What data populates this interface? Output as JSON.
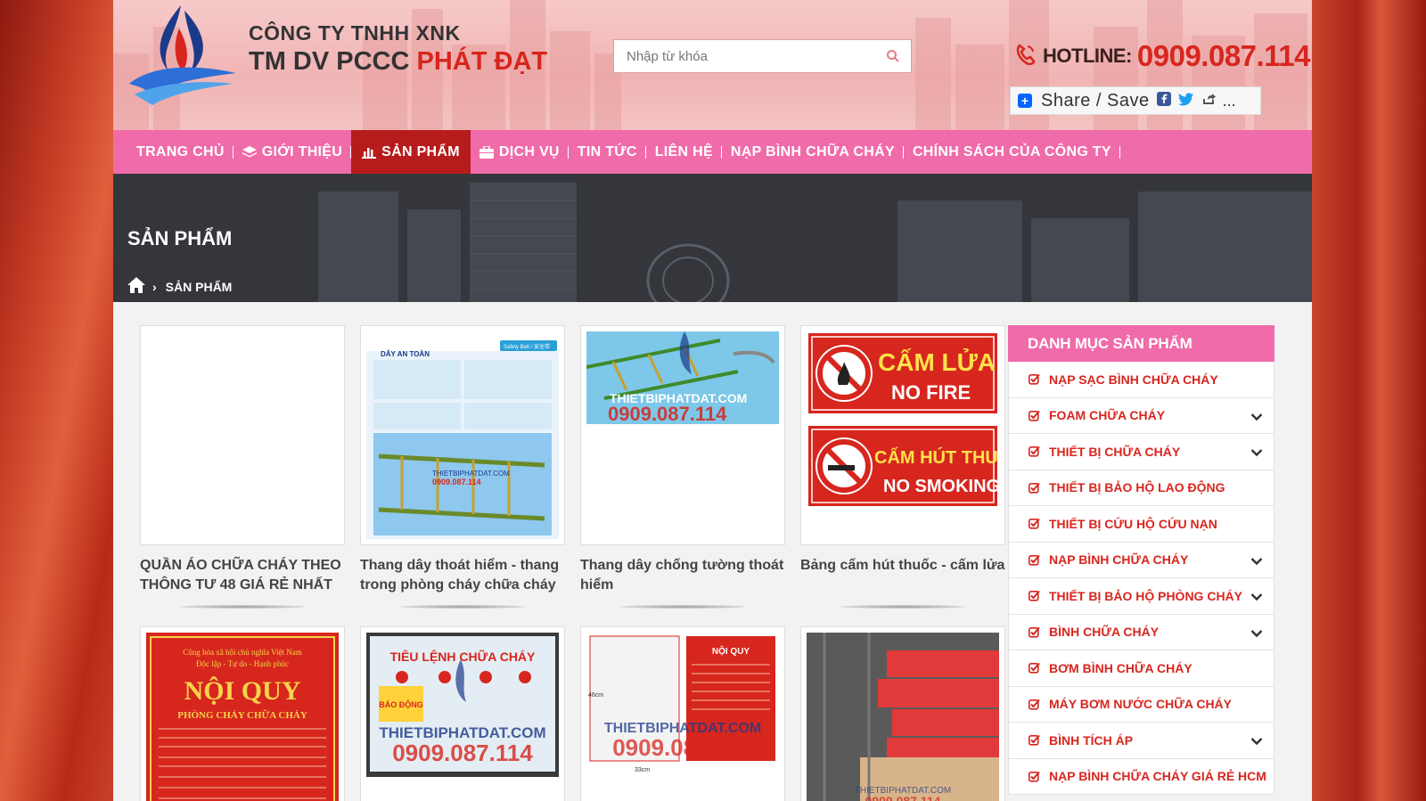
{
  "header": {
    "company_line1": "CÔNG TY TNHH XNK",
    "company_line2_prefix": "TM DV PCCC",
    "company_line2_brand": "PHÁT ĐẠT",
    "search_placeholder": "Nhập từ khóa",
    "hotline_label": "HOTLINE:",
    "hotline_number": "0909.087.114",
    "share_label": "Share / Save",
    "share_more": "..."
  },
  "nav": {
    "items": [
      {
        "label": "TRANG CHỦ",
        "icon": ""
      },
      {
        "label": "GIỚI THIỆU",
        "icon": "layers-icon"
      },
      {
        "label": "SẢN PHẨM",
        "icon": "chart-icon",
        "active": true
      },
      {
        "label": "DỊCH VỤ",
        "icon": "briefcase-icon"
      },
      {
        "label": "TIN TỨC",
        "icon": ""
      },
      {
        "label": "LIÊN HỆ",
        "icon": ""
      },
      {
        "label": "NẠP BÌNH CHỮA CHÁY",
        "icon": ""
      },
      {
        "label": "CHÍNH SÁCH CỦA CÔNG TY",
        "icon": ""
      }
    ]
  },
  "banner": {
    "title": "SẢN PHẨM",
    "breadcrumb_current": "SẢN PHẨM"
  },
  "products": [
    {
      "name": "QUẦN ÁO CHỮA CHÁY THEO THÔNG TƯ 48 GIÁ RẺ NHẤT"
    },
    {
      "name": "Thang dây thoát hiểm - thang trong phòng cháy chữa cháy"
    },
    {
      "name": "Thang dây chống tường thoát hiểm"
    },
    {
      "name": "Bảng cấm hút thuốc - cấm lửa"
    }
  ],
  "product_images": {
    "safety_title": "DÂY AN TOÀN",
    "safety_badge": "Safety Belt / 安全带",
    "watermark_site": "THIETBIPHATDAT.COM",
    "watermark_phone": "0909.087.114",
    "sign_fire_vi": "CẤM LỬA",
    "sign_fire_en": "NO FIRE",
    "sign_smoke_vi": "CẤM HÚT THUỐC",
    "sign_smoke_en": "NO SMOKING",
    "rules_header1": "Cộng hòa xã hội chủ nghĩa Việt Nam",
    "rules_header2": "Độc lập - Tự do - Hạnh phúc",
    "rules_title": "NỘI QUY",
    "rules_subtitle": "PHÒNG CHÁY CHỮA CHÁY",
    "command_title": "TIÊU LỆNH CHỮA CHÁY",
    "alarm_text": "BÁO ĐỘNG",
    "rules2_title": "NỘI QUY",
    "dim_46": "46cm",
    "dim_33": "33cm"
  },
  "sidebar": {
    "title": "DANH MỤC SẢN PHẨM",
    "items": [
      {
        "label": "NẠP SẠC BÌNH CHỮA CHÁY",
        "expandable": false
      },
      {
        "label": "FOAM CHỮA CHÁY",
        "expandable": true
      },
      {
        "label": "THIẾT BỊ CHỮA CHÁY",
        "expandable": true
      },
      {
        "label": "THIẾT BỊ BẢO HỘ LAO ĐỘNG",
        "expandable": false
      },
      {
        "label": "THIẾT BỊ CỨU HỘ CỨU NẠN",
        "expandable": false
      },
      {
        "label": "NẠP BÌNH CHỮA CHÁY",
        "expandable": true
      },
      {
        "label": "THIẾT BỊ BẢO HỘ PHÒNG CHÁY",
        "expandable": true
      },
      {
        "label": "BÌNH CHỮA CHÁY",
        "expandable": true
      },
      {
        "label": "BƠM BÌNH CHỮA CHÁY",
        "expandable": false
      },
      {
        "label": "MÁY BƠM NƯỚC CHỮA CHÁY",
        "expandable": false
      },
      {
        "label": "BÌNH TÍCH ÁP",
        "expandable": true
      },
      {
        "label": "NẠP BÌNH CHỮA CHÁY GIÁ RẺ HCM",
        "expandable": false
      }
    ]
  },
  "colors": {
    "brand_red": "#d7261e",
    "nav_pink": "#f06ba9",
    "nav_active": "#b71c1c"
  }
}
